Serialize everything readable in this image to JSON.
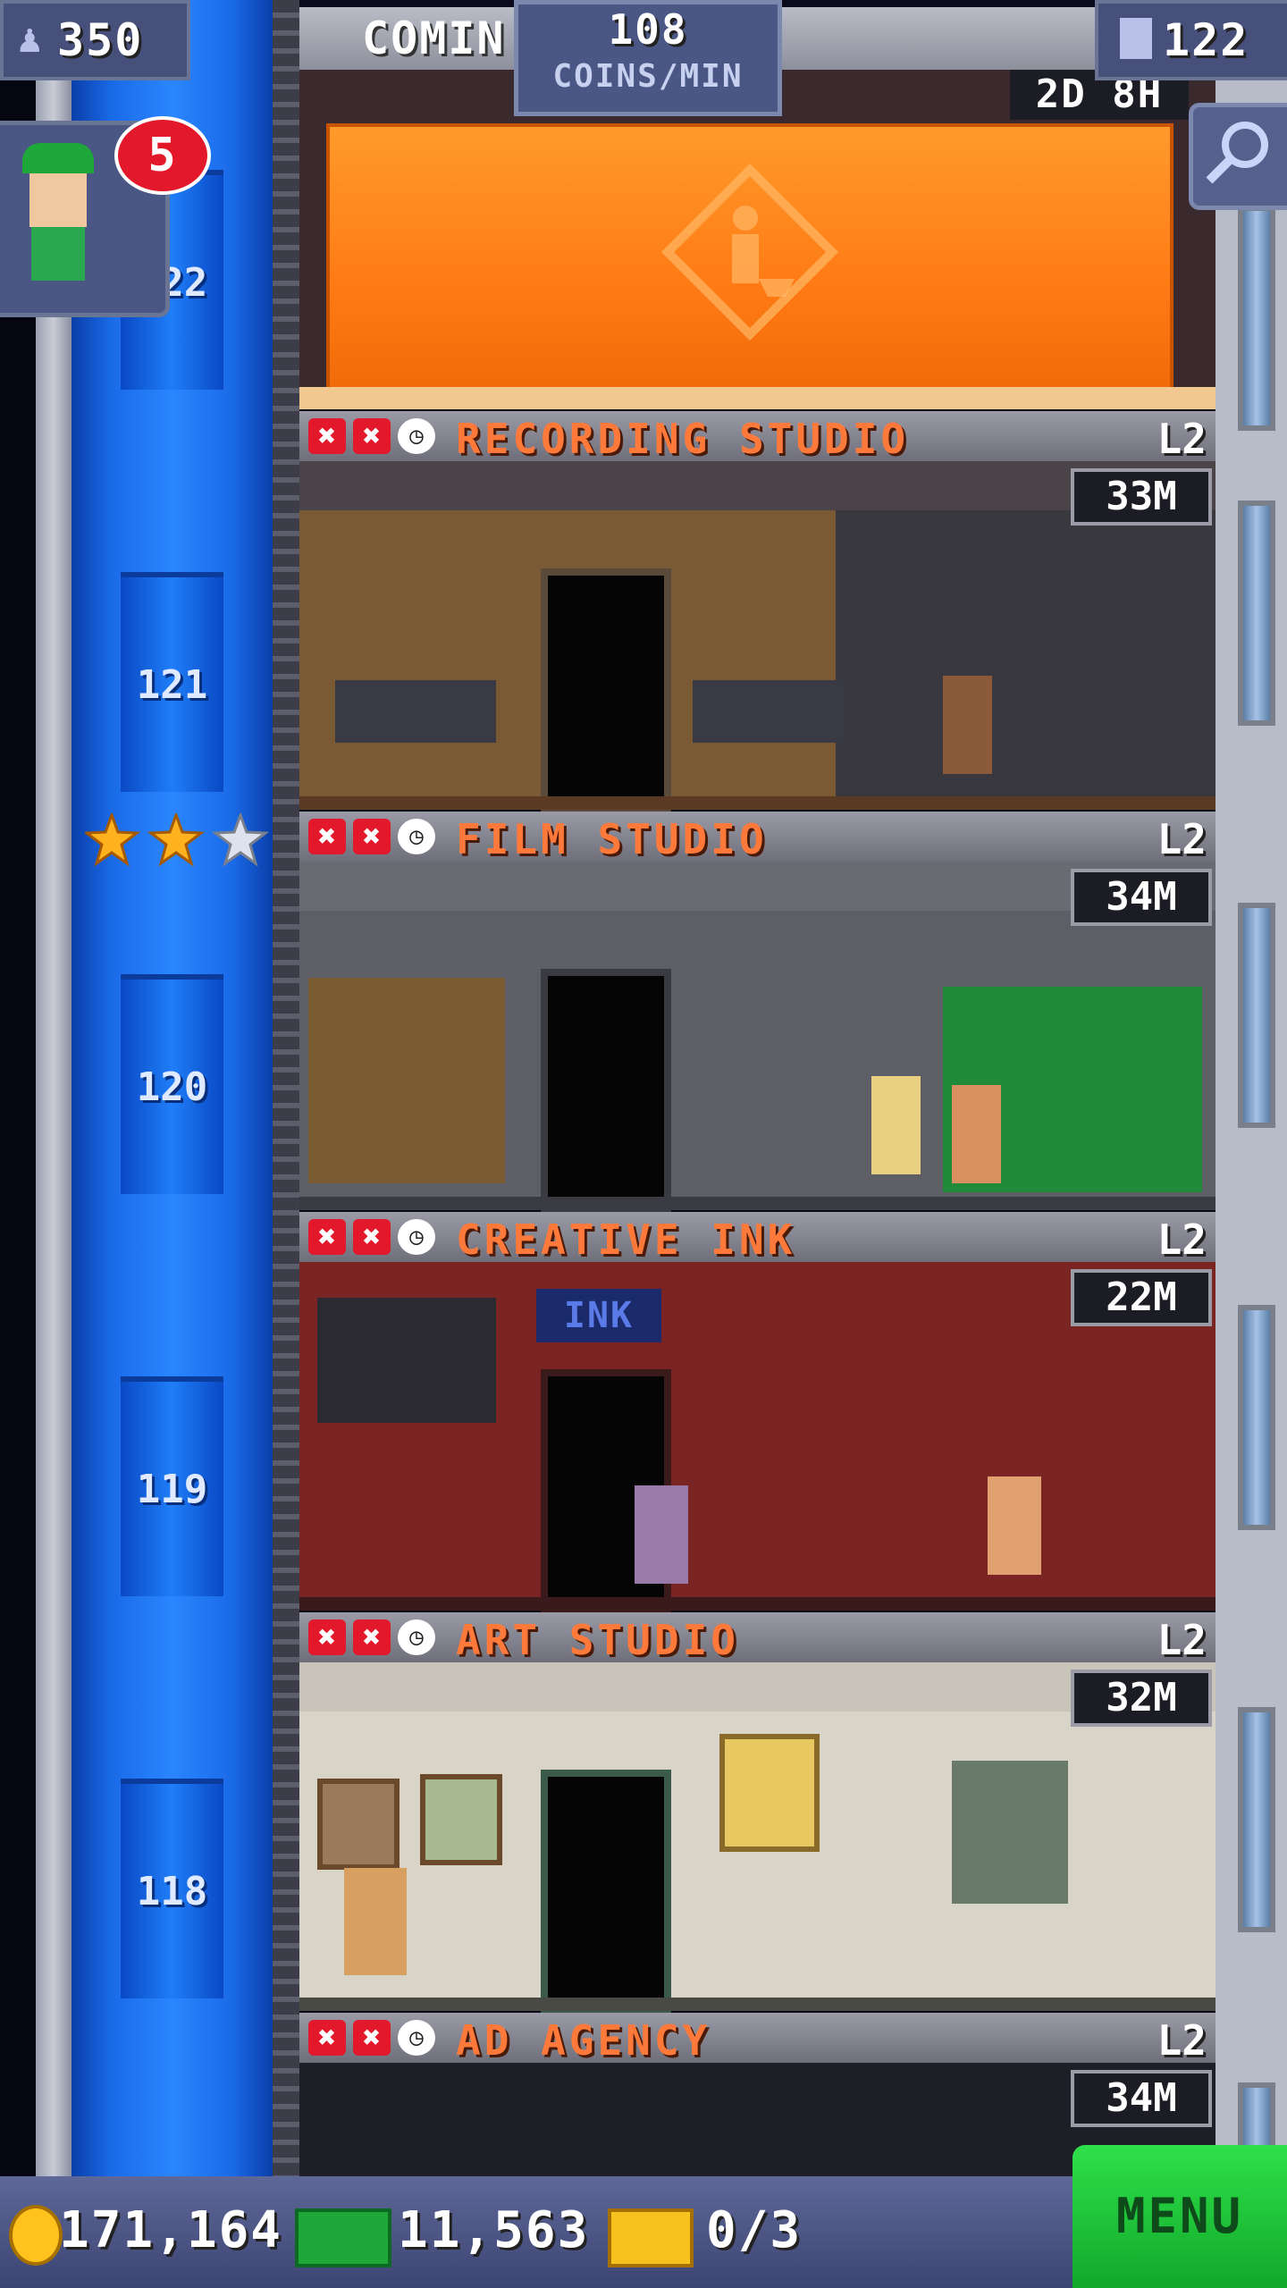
{
  "hud": {
    "population": "350",
    "coming_soon_label": "COMIN",
    "coins_per_min_value": "108",
    "coins_per_min_label": "COINS/MIN",
    "floor_count": "122",
    "build_timer": "2D 8H"
  },
  "notification": {
    "badge_count": "5"
  },
  "shaft_floor_numbers": [
    "122",
    "121",
    "120",
    "119",
    "118"
  ],
  "rating_stars": {
    "filled": 2,
    "total": 3
  },
  "floors": [
    {
      "name": "RECORDING STUDIO",
      "level": "L2",
      "timer": "33M"
    },
    {
      "name": "FILM STUDIO",
      "level": "L2",
      "timer": "34M"
    },
    {
      "name": "CREATIVE INK",
      "level": "L2",
      "timer": "22M",
      "sign": "INK"
    },
    {
      "name": "ART STUDIO",
      "level": "L2",
      "timer": "32M"
    },
    {
      "name": "AD AGENCY",
      "level": "L2",
      "timer": "34M"
    }
  ],
  "bottom": {
    "coins": "171,164",
    "bux": "11,563",
    "tickets": "0/3",
    "menu_label": "MENU"
  },
  "colors": {
    "shaft_blue": "#1a6ae8",
    "floor_name": "#ff7a3a",
    "menu_green": "#2ee04a",
    "construction_orange": "#ff8a1e",
    "badge_red": "#e3182a"
  }
}
